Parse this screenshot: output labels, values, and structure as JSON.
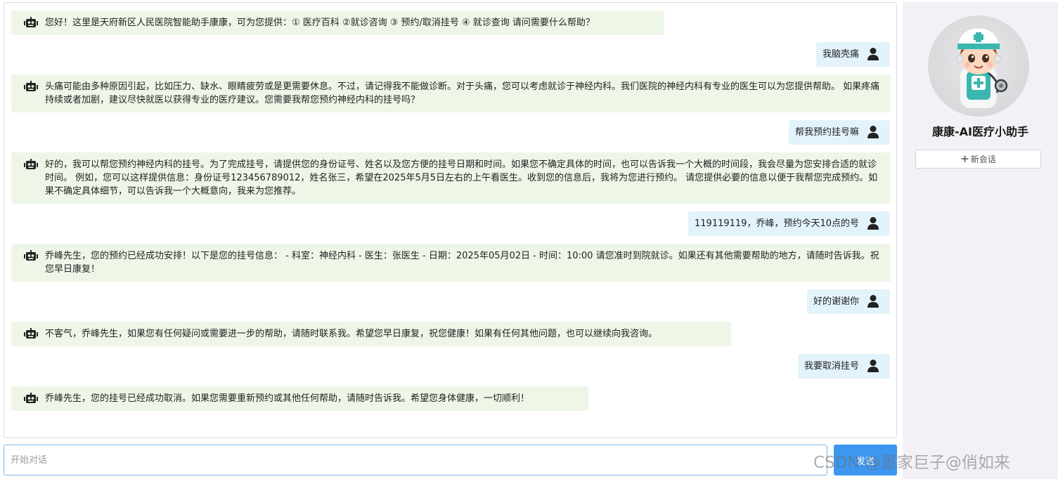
{
  "messages": [
    {
      "role": "bot",
      "text": "您好！这里是天府新区人民医院智能助手康康，可为您提供：① 医疗百科 ②就诊咨询 ③ 预约/取消挂号 ④ 就诊查询 请问需要什么帮助？"
    },
    {
      "role": "user",
      "text": "我脑壳痛"
    },
    {
      "role": "bot",
      "text": "头痛可能由多种原因引起，比如压力、缺水、眼睛疲劳或是更需要休息。不过，请记得我不能做诊断。对于头痛，您可以考虑就诊于神经内科。我们医院的神经内科有专业的医生可以为您提供帮助。 如果疼痛持续或者加剧，建议尽快就医以获得专业的医疗建议。您需要我帮您预约神经内科的挂号吗？"
    },
    {
      "role": "user",
      "text": "帮我预约挂号嘛"
    },
    {
      "role": "bot",
      "text": "好的，我可以帮您预约神经内科的挂号。为了完成挂号，请提供您的身份证号、姓名以及您方便的挂号日期和时间。如果您不确定具体的时间，也可以告诉我一个大概的时间段，我会尽量为您安排合适的就诊时间。 例如，您可以这样提供信息：身份证号123456789012，姓名张三，希望在2025年5月5日左右的上午看医生。收到您的信息后，我将为您进行预约。 请您提供必要的信息以便于我帮您完成预约。如果不确定具体细节，可以告诉我一个大概意向，我来为您推荐。"
    },
    {
      "role": "user",
      "text": "119119119，乔峰，预约今天10点的号"
    },
    {
      "role": "bot",
      "text": "乔峰先生，您的预约已经成功安排！以下是您的挂号信息： - 科室：神经内科 - 医生：张医生 - 日期：2025年05月02日 - 时间：10:00 请您准时到院就诊。如果还有其他需要帮助的地方，请随时告诉我。祝您早日康复！"
    },
    {
      "role": "user",
      "text": "好的谢谢你"
    },
    {
      "role": "bot",
      "text": "不客气，乔峰先生，如果您有任何疑问或需要进一步的帮助，请随时联系我。希望您早日康复，祝您健康！如果有任何其他问题，也可以继续向我咨询。"
    },
    {
      "role": "user",
      "text": "我要取消挂号"
    },
    {
      "role": "bot",
      "text": "乔峰先生，您的挂号已经成功取消。如果您需要重新预约或其他任何帮助，请随时告诉我。希望您身体健康，一切顺利！"
    }
  ],
  "sidebar": {
    "assistant_name": "康康-AI医疗小助手",
    "new_chat_label": "新会话",
    "new_chat_icon": "plus-icon"
  },
  "input": {
    "placeholder": "开始对话",
    "value": ""
  },
  "send_label": "发送",
  "watermark": "CSDN @墨家巨子@俏如来",
  "colors": {
    "bot_bubble": "#eef6e8",
    "user_bubble": "#e3f3fb",
    "send_button": "#3d97f0",
    "sidebar_bg": "#f2f2f6"
  }
}
